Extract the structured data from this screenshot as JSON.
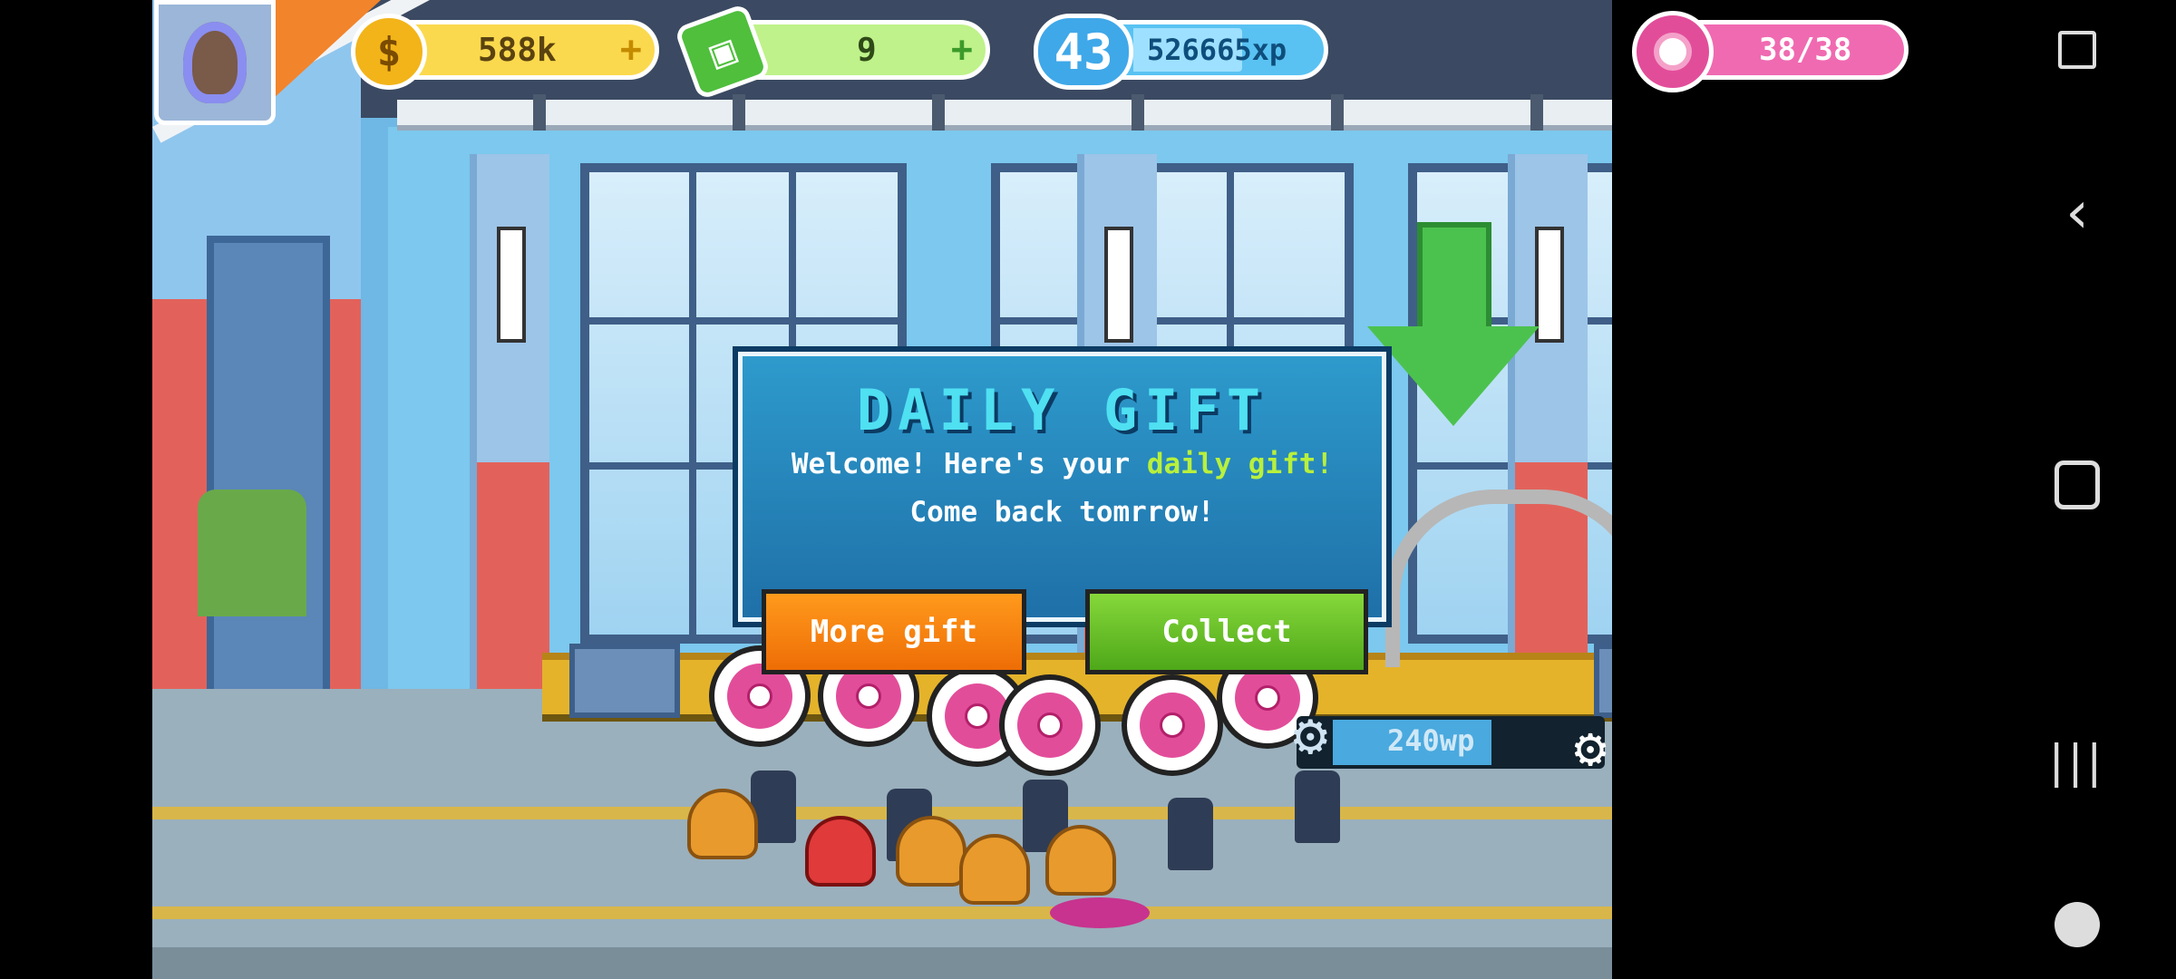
{
  "hud": {
    "coins": "588k",
    "cash": "9",
    "level": "43",
    "xp": "526665xp",
    "donuts": "38/38",
    "plus": "+"
  },
  "dialog": {
    "title": "DAILY GIFT",
    "message_start": "Welcome! Here's your ",
    "message_highlight": "daily gift!",
    "message_end": "Come back tomrrow!",
    "more_gift_label": "More gift",
    "collect_label": "Collect"
  },
  "worker_badge": {
    "value": "240wp"
  },
  "icons": {
    "coin": "coin-icon",
    "cash": "cash-icon",
    "xp": "xp-star-icon",
    "donut": "donut-icon",
    "screenshot": "screenshot-icon",
    "back": "back-icon",
    "home": "home-icon",
    "recent": "recent-apps-icon",
    "game": "game-tools-icon"
  },
  "colors": {
    "more_gift_button": "#ee6d06",
    "collect_button": "#4ea819",
    "dialog_bg": "#1e6fa7",
    "title_text": "#4fe0f2",
    "highlight_text": "#b8f03c"
  }
}
